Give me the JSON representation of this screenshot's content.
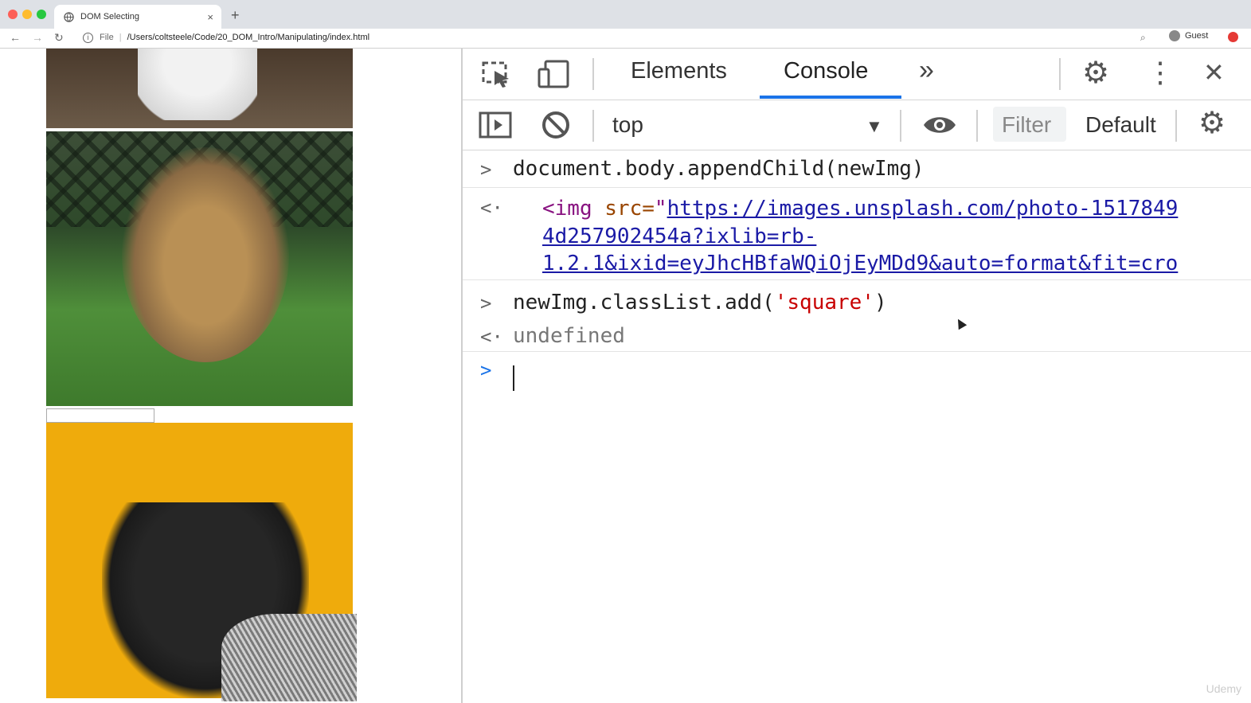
{
  "browser": {
    "tab_title": "DOM Selecting",
    "tab_close": "×",
    "new_tab": "+",
    "back": "←",
    "forward": "→",
    "reload": "↻",
    "info": "i",
    "url_scheme": "File",
    "url_path": "/Users/coltsteele/Code/20_DOM_Intro/Manipulating/index.html",
    "zoom_icon": "⌕",
    "profile_label": "Guest"
  },
  "devtools": {
    "tabs": {
      "elements": "Elements",
      "console": "Console",
      "more": "»"
    },
    "close": "✕",
    "kebab": "⋮",
    "settings": "⚙",
    "context": "top",
    "context_arrow": "▼",
    "filter_placeholder": "Filter",
    "levels": "Default levels"
  },
  "console": {
    "lines": [
      {
        "prompt": ">",
        "text": "document.body.appendChild(newImg)"
      },
      {
        "prompt": "<·",
        "tag_open": "<img",
        "attr": " src=",
        "quote": "\"",
        "url_line1": "https://images.unsplash.com/photo-1517849",
        "url_line2": "4d257902454a?ixlib=rb-",
        "url_line3": "1.2.1&ixid=eyJhcHBfaWQiOjEyMDd9&auto=format&fit=cro"
      },
      {
        "prompt": ">",
        "text_pre": "newImg.classList.add(",
        "text_str": "'square'",
        "text_post": ")"
      },
      {
        "prompt": "<·",
        "text": "undefined"
      },
      {
        "prompt": ">"
      }
    ]
  },
  "watermark": "Udemy",
  "colors": {
    "accent": "#1a73e8",
    "page_bg_yellow": "#efab0c"
  }
}
